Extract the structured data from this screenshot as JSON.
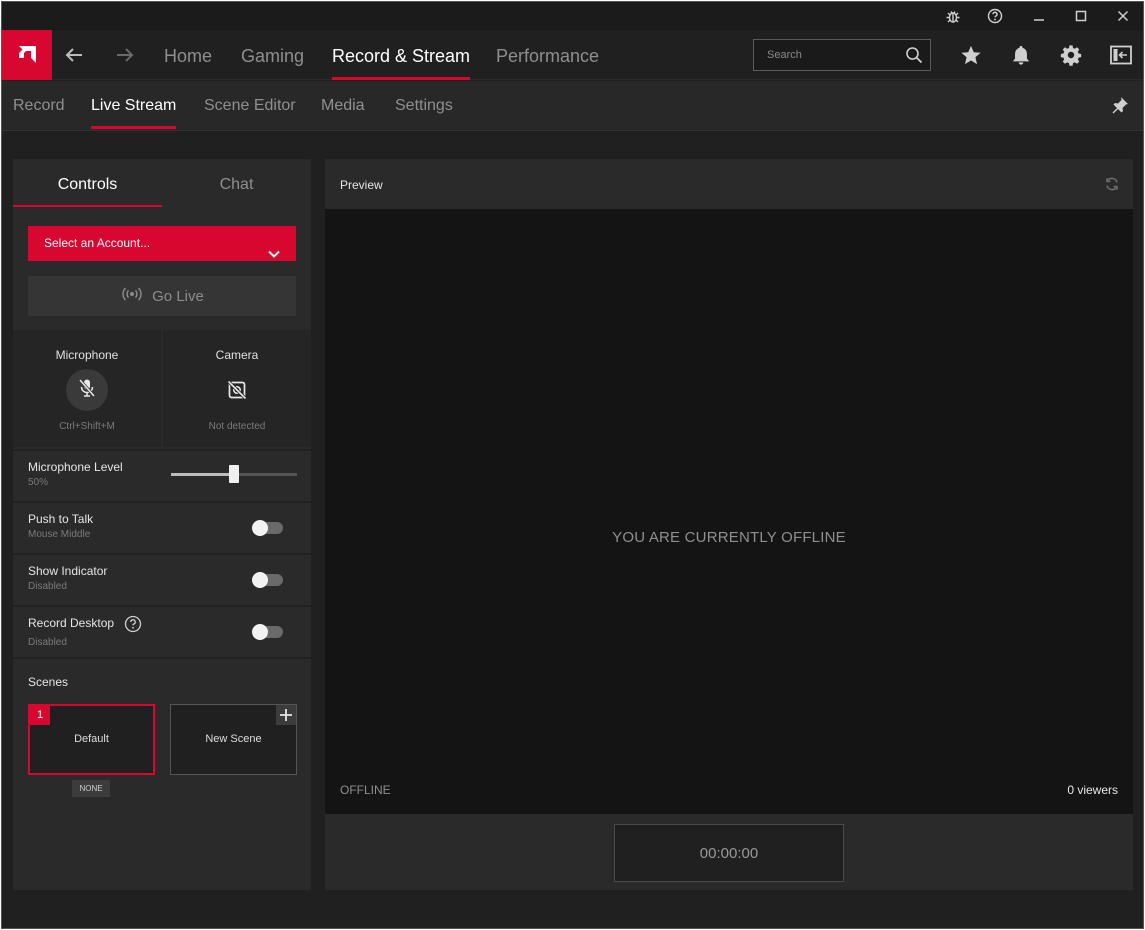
{
  "nav": {
    "tabs": [
      {
        "label": "Home"
      },
      {
        "label": "Gaming"
      },
      {
        "label": "Record & Stream"
      },
      {
        "label": "Performance"
      }
    ],
    "search_placeholder": "Search"
  },
  "subnav": {
    "tabs": [
      {
        "label": "Record"
      },
      {
        "label": "Live Stream"
      },
      {
        "label": "Scene Editor"
      },
      {
        "label": "Media"
      },
      {
        "label": "Settings"
      }
    ]
  },
  "panel": {
    "tabs": [
      {
        "label": "Controls"
      },
      {
        "label": "Chat"
      }
    ],
    "select_account": "Select an Account...",
    "go_live": "Go Live",
    "microphone": {
      "title": "Microphone",
      "hotkey": "Ctrl+Shift+M"
    },
    "camera": {
      "title": "Camera",
      "status": "Not detected"
    },
    "mic_level": {
      "label": "Microphone Level",
      "value_text": "50%",
      "value": 0.5
    },
    "push_to_talk": {
      "label": "Push to Talk",
      "sub": "Mouse Middle",
      "enabled": false
    },
    "show_indicator": {
      "label": "Show Indicator",
      "sub": "Disabled",
      "enabled": false
    },
    "record_desktop": {
      "label": "Record Desktop",
      "sub": "Disabled",
      "enabled": false
    },
    "scenes": {
      "label": "Scenes",
      "items": [
        {
          "number": "1",
          "name": "Default",
          "badge": "NONE"
        },
        {
          "name": "New Scene"
        }
      ]
    }
  },
  "preview": {
    "title": "Preview",
    "message": "YOU ARE CURRENTLY OFFLINE",
    "status": "OFFLINE",
    "viewers": "0 viewers",
    "timer": "00:00:00"
  },
  "colors": {
    "accent": "#d7072f",
    "background": "#202020",
    "panel": "#2a2a2a"
  }
}
